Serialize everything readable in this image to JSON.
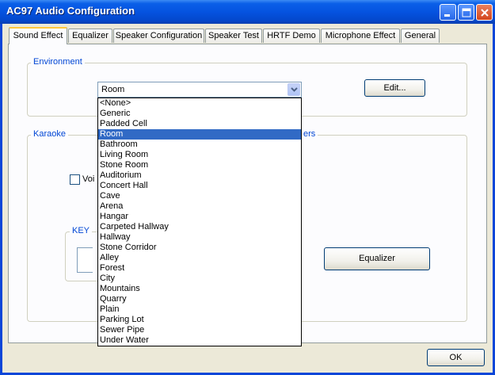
{
  "window": {
    "title": "AC97 Audio Configuration"
  },
  "tabs": [
    {
      "label": "Sound Effect",
      "active": true
    },
    {
      "label": "Equalizer",
      "active": false
    },
    {
      "label": "Speaker Configuration",
      "active": false
    },
    {
      "label": "Speaker Test",
      "active": false
    },
    {
      "label": "HRTF Demo",
      "active": false
    },
    {
      "label": "Microphone Effect",
      "active": false
    },
    {
      "label": "General",
      "active": false
    }
  ],
  "environment": {
    "group_label": "Environment",
    "selected": "Room",
    "edit_label": "Edit...",
    "options": [
      "<None>",
      "Generic",
      "Padded Cell",
      "Room",
      "Bathroom",
      "Living Room",
      "Stone Room",
      "Auditorium",
      "Concert Hall",
      "Cave",
      "Arena",
      "Hangar",
      "Carpeted Hallway",
      "Hallway",
      "Stone Corridor",
      "Alley",
      "Forest",
      "City",
      "Mountains",
      "Quarry",
      "Plain",
      "Parking Lot",
      "Sewer Pipe",
      "Under Water"
    ]
  },
  "karaoke": {
    "group_label": "Karaoke",
    "voice_fragment": "Voi",
    "key_label": "KEY"
  },
  "other": {
    "group_label_fragment": "ers",
    "equalizer_label": "Equalizer"
  },
  "footer": {
    "ok_label": "OK"
  },
  "colors": {
    "titlebar": "#0553e0",
    "selection": "#316ac5",
    "group_label": "#0046d5",
    "tab_highlight": "#ffc83c"
  }
}
